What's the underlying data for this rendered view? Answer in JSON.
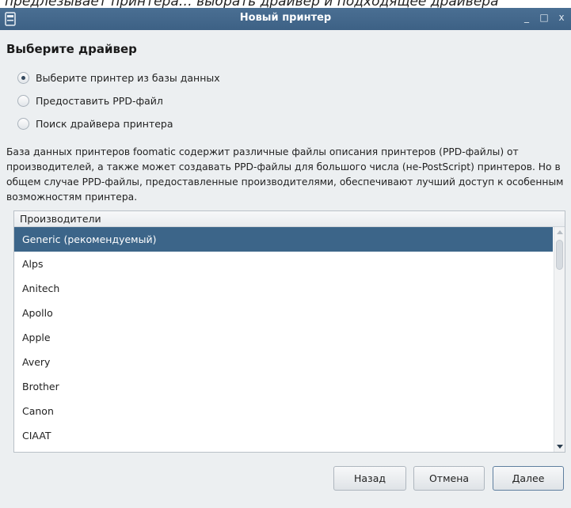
{
  "caption": "предлезывает принтера… выбрать драйвер и подходящее драйвера",
  "window": {
    "title": "Новый принтер",
    "controls": {
      "minimize": "_",
      "maximize": "□",
      "close": "x"
    }
  },
  "heading": "Выберите драйвер",
  "options": [
    {
      "label": "Выберите принтер из базы данных",
      "checked": true
    },
    {
      "label": "Предоставить PPD-файл",
      "checked": false
    },
    {
      "label": "Поиск драйвера принтера",
      "checked": false
    }
  ],
  "description": "База данных принтеров foomatic содержит различные файлы описания принтеров (PPD-файлы) от производителей, а также может создавать PPD-файлы для большого числа (не-PostScript) принтеров. Но в общем случае PPD-файлы, предоставленные производителями, обеспечивают лучший доступ к особенным возможностям принтера.",
  "manufacturers": {
    "header": "Производители",
    "items": [
      "Generic (рекомендуемый)",
      "Alps",
      "Anitech",
      "Apollo",
      "Apple",
      "Avery",
      "Brother",
      "Canon",
      "CIAAT"
    ],
    "selected_index": 0
  },
  "buttons": {
    "back": "Назад",
    "cancel": "Отмена",
    "next": "Далее"
  },
  "colors": {
    "titlebar": "#3d6185",
    "selection": "#3c6589",
    "window_bg": "#eceff1"
  }
}
